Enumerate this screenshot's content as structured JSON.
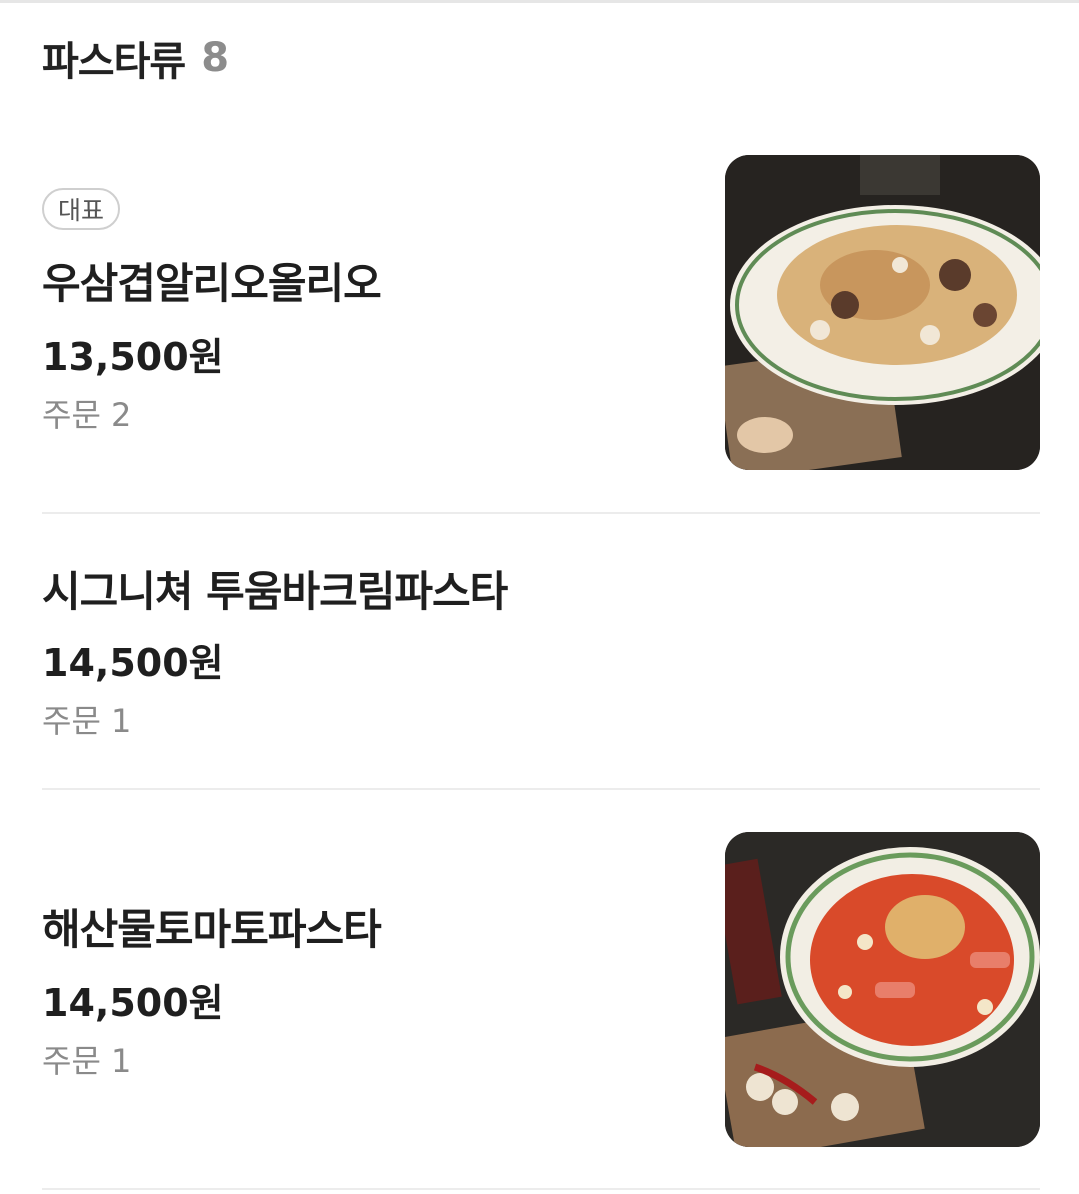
{
  "section": {
    "title": "파스타류",
    "count": "8"
  },
  "items": [
    {
      "badge": "대표",
      "name": "우삼겹알리오올리오",
      "price": "13,500원",
      "orders": "주문 2",
      "image": "aglio-olio-pasta-photo"
    },
    {
      "name": "시그니쳐 투움바크림파스타",
      "price": "14,500원",
      "orders": "주문 1"
    },
    {
      "name": "해산물토마토파스타",
      "price": "14,500원",
      "orders": "주문 1",
      "image": "tomato-seafood-pasta-photo"
    }
  ]
}
